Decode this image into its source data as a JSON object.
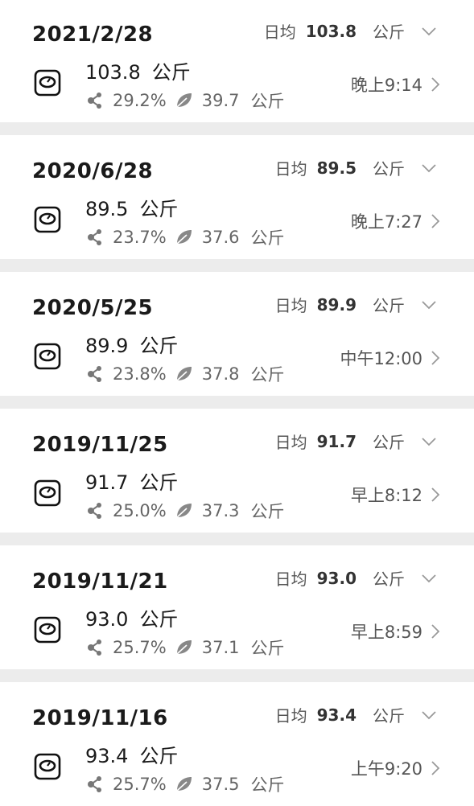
{
  "records": [
    {
      "date": "2021/2/28",
      "avg_label": "日均",
      "avg_value": "103.8",
      "avg_unit": "公斤",
      "weight": "103.8",
      "weight_unit": "公斤",
      "body_fat": "29.2%",
      "muscle": "39.7",
      "muscle_unit": "公斤",
      "time": "晚上9:14"
    },
    {
      "date": "2020/6/28",
      "avg_label": "日均",
      "avg_value": "89.5",
      "avg_unit": "公斤",
      "weight": "89.5",
      "weight_unit": "公斤",
      "body_fat": "23.7%",
      "muscle": "37.6",
      "muscle_unit": "公斤",
      "time": "晚上7:27"
    },
    {
      "date": "2020/5/25",
      "avg_label": "日均",
      "avg_value": "89.9",
      "avg_unit": "公斤",
      "weight": "89.9",
      "weight_unit": "公斤",
      "body_fat": "23.8%",
      "muscle": "37.8",
      "muscle_unit": "公斤",
      "time": "中午12:00"
    },
    {
      "date": "2019/11/25",
      "avg_label": "日均",
      "avg_value": "91.7",
      "avg_unit": "公斤",
      "weight": "91.7",
      "weight_unit": "公斤",
      "body_fat": "25.0%",
      "muscle": "37.3",
      "muscle_unit": "公斤",
      "time": "早上8:12"
    },
    {
      "date": "2019/11/21",
      "avg_label": "日均",
      "avg_value": "93.0",
      "avg_unit": "公斤",
      "weight": "93.0",
      "weight_unit": "公斤",
      "body_fat": "25.7%",
      "muscle": "37.1",
      "muscle_unit": "公斤",
      "time": "早上8:59"
    },
    {
      "date": "2019/11/16",
      "avg_label": "日均",
      "avg_value": "93.4",
      "avg_unit": "公斤",
      "weight": "93.4",
      "weight_unit": "公斤",
      "body_fat": "25.7%",
      "muscle": "37.5",
      "muscle_unit": "公斤",
      "time": "上午9:20"
    }
  ],
  "icons": {
    "scale": "scale-icon",
    "body_fat": "molecule-icon",
    "muscle": "leaf-icon",
    "expand": "chevron-down-icon",
    "open": "chevron-right-icon"
  }
}
